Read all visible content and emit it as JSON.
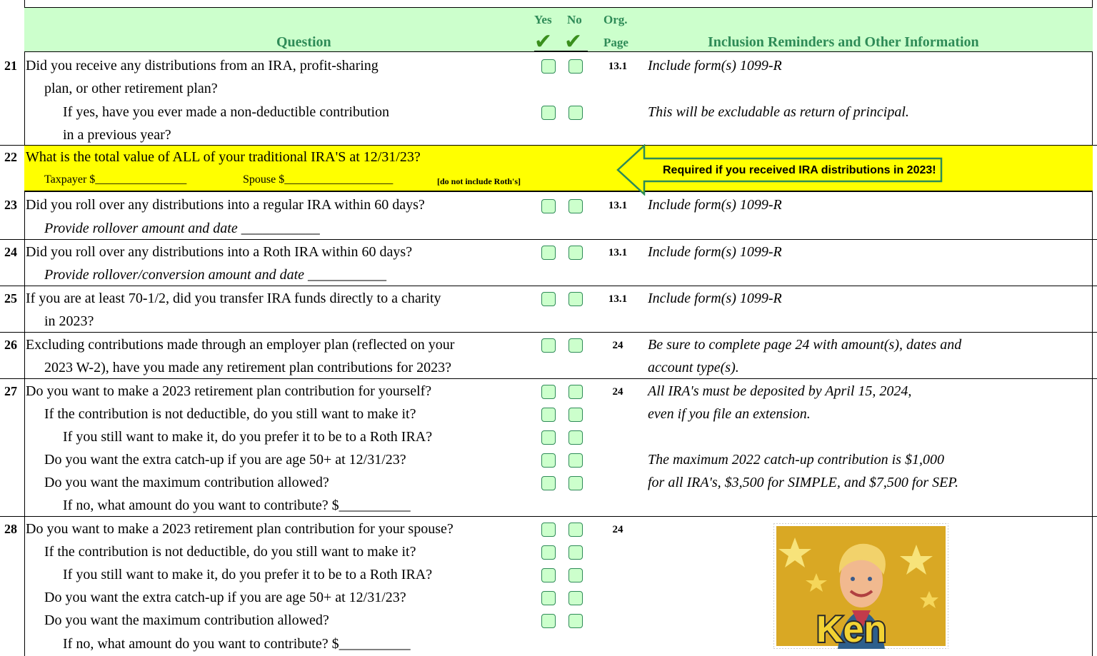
{
  "header": {
    "yes": "Yes",
    "no": "No",
    "org": "Org.",
    "page": "Page",
    "question": "Question",
    "info": "Inclusion Reminders and Other Information",
    "check_icon": "check-icon",
    "color_header": "#ccffcc",
    "color_text": "#2e8b57"
  },
  "q21": {
    "num": "21",
    "line1": "Did you receive any distributions from an IRA, profit-sharing",
    "line2": "plan, or other retirement plan?",
    "line3": "If yes, have you ever made a non-deductible contribution",
    "line4": "in a previous year?",
    "page": "13.1",
    "info1": "Include form(s) 1099-R",
    "info2": "This will be excludable as return of principal."
  },
  "q22": {
    "num": "22",
    "line1": "What is the total value of ALL of your traditional IRA'S at 12/31/23?",
    "taxpayer": "Taxpayer $________________",
    "spouse": "Spouse $___________________",
    "note": "[do not include Roth's]",
    "callout": "Required if you received IRA distributions in 2023!",
    "color_highlight": "#ffff00"
  },
  "q23": {
    "num": "23",
    "line1": "Did you roll over any distributions into a regular IRA within 60 days?",
    "line2": "Provide rollover amount and date ___________",
    "page": "13.1",
    "info1": "Include form(s) 1099-R"
  },
  "q24": {
    "num": "24",
    "line1": "Did you roll over any distributions into a Roth IRA within 60 days?",
    "line2": "Provide rollover/conversion amount and date ___________",
    "page": "13.1",
    "info1": "Include form(s) 1099-R"
  },
  "q25": {
    "num": "25",
    "line1": "If you are at least 70-1/2, did you transfer IRA funds directly to a charity",
    "line2": "in 2023?",
    "page": "13.1",
    "info1": "Include form(s) 1099-R"
  },
  "q26": {
    "num": "26",
    "line1": "Excluding contributions made through an employer plan (reflected on your",
    "line2": "2023 W-2), have you made any retirement plan contributions for 2023?",
    "page": "24",
    "info1": "Be sure to complete page 24 with amount(s), dates and",
    "info2": "account type(s)."
  },
  "q27": {
    "num": "27",
    "line1": "Do you want to make a 2023 retirement plan contribution for yourself?",
    "line2": "If the contribution is not deductible, do you still want to make it?",
    "line3": "If you still want to make it, do you prefer it to be to a Roth IRA?",
    "line4": "Do you want the extra catch-up if you are age 50+ at 12/31/23?",
    "line5": "Do you want the maximum contribution allowed?",
    "line6": "If no, what amount do you want to contribute?  $__________",
    "page": "24",
    "info1": "All IRA's must be deposited by April 15, 2024,",
    "info2": "even if you file an extension.",
    "info3": "The maximum 2022 catch-up contribution is $1,000",
    "info4": "for all IRA's, $3,500 for SIMPLE, and $7,500 for SEP."
  },
  "q28": {
    "num": "28",
    "line1": "Do you want to make a 2023 retirement plan contribution for your spouse?",
    "line2": "If the contribution is not deductible, do you still want to make it?",
    "line3": "If you still want to make it, do you prefer it to be to a Roth IRA?",
    "line4": "Do you want the extra catch-up if you are age 50+ at 12/31/23?",
    "line5": "Do you want the maximum contribution allowed?",
    "line6": "If no, what amount do you want to contribute?  $__________",
    "page": "24"
  },
  "ken_image": {
    "logo_text": "Ken"
  }
}
